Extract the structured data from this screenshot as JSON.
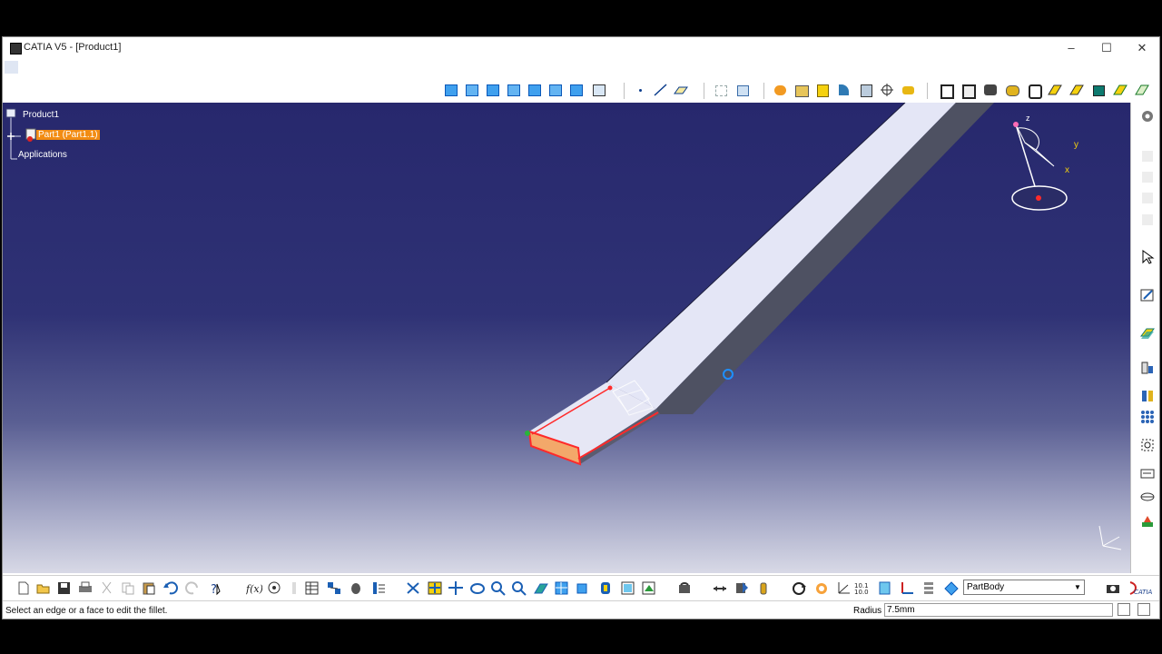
{
  "window": {
    "title": "CATIA V5 - [Product1]",
    "minimize": "–",
    "maximize": "☐",
    "close": "✕"
  },
  "tree": {
    "root": "Product1",
    "part": "Part1 (Part1.1)",
    "applications": "Applications"
  },
  "compass": {
    "x": "x",
    "y": "y",
    "z": "z"
  },
  "workbench_combo": {
    "value": "PartBody"
  },
  "status": {
    "message": "Select an edge or a face to edit the fillet.",
    "radius_label": "Radius",
    "radius_value": "7.5mm"
  },
  "colors": {
    "viewport_top": "#27286d",
    "viewport_bottom": "#d8d9e6",
    "selection": "#f28c13",
    "edge_highlight": "#ff2a2a",
    "part_face": "#e4e6f6",
    "part_side": "#4e5162"
  },
  "icons": {
    "top_toolbar": [
      "pad-icon",
      "pocket-icon",
      "shaft-icon",
      "groove-icon",
      "hole-icon",
      "rib-icon",
      "slot-icon",
      "point-icon",
      "line-icon",
      "plane-icon",
      "grid-icon",
      "snap-icon",
      "material-icon",
      "apply-material-icon",
      "box-icon",
      "fillet-icon",
      "chamfer-icon",
      "axis-icon",
      "shell-icon",
      "thickness-icon",
      "mirror-icon",
      "pattern-icon",
      "scale-icon",
      "split-icon",
      "thick-surface-icon",
      "close-surface-icon",
      "sew-surface-icon"
    ],
    "right_toolbar": [
      "settings-icon",
      "select-icon",
      "sketch-icon",
      "surface-icon",
      "constraint-icon",
      "measure-icon",
      "pattern-icon",
      "analysis-icon",
      "annotation-icon",
      "render-icon"
    ],
    "bottom_toolbar": [
      "new-icon",
      "open-icon",
      "save-icon",
      "print-icon",
      "cut-icon",
      "copy-icon",
      "paste-icon",
      "undo-icon",
      "redo-icon",
      "whats-this-icon",
      "formula-icon",
      "knowledge-icon",
      "table-icon",
      "catalog-icon",
      "view-icon",
      "fly-icon",
      "fit-all-icon",
      "pan-icon",
      "rotate-icon",
      "zoom-in-icon",
      "zoom-out-icon",
      "normal-view-icon",
      "multi-view-icon",
      "iso-view-icon",
      "hide-show-icon",
      "swap-icon",
      "update-icon",
      "measure-icon",
      "analysis-icon",
      "light-icon",
      "compass-icon",
      "scan-icon",
      "geometry-icon",
      "body-icon",
      "camera-icon",
      "catia-logo"
    ]
  }
}
